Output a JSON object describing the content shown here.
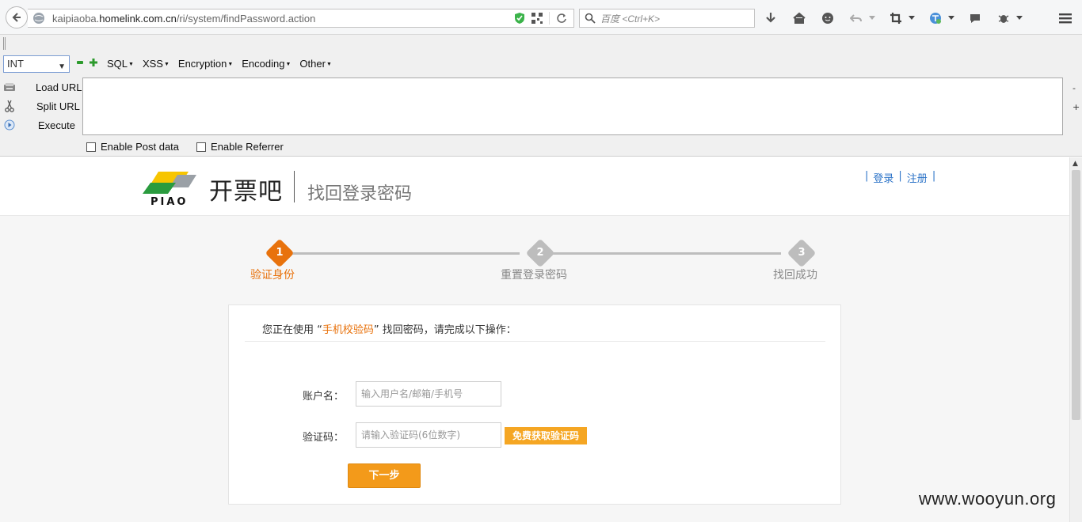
{
  "browser": {
    "url_prefix": "kaipiaoba.",
    "url_host": "homelink.com.cn",
    "url_path": "/ri/system/findPassword.action",
    "search_placeholder": "百度 <Ctrl+K>"
  },
  "hackbar": {
    "select_value": "INT",
    "menus": [
      "SQL",
      "XSS",
      "Encryption",
      "Encoding",
      "Other"
    ],
    "actions": [
      "Load URL",
      "Split URL",
      "Execute"
    ],
    "side_minus": "-",
    "side_plus": "+",
    "checkboxes": [
      "Enable Post data",
      "Enable Referrer"
    ]
  },
  "header": {
    "brand": "开票吧",
    "title": "找回登录密码",
    "login": "登录",
    "register": "注册",
    "bar": "|"
  },
  "steps": [
    {
      "num": "1",
      "label": "验证身份"
    },
    {
      "num": "2",
      "label": "重置登录密码"
    },
    {
      "num": "3",
      "label": "找回成功"
    }
  ],
  "form": {
    "intro_before": "您正在使用 “",
    "intro_highlight": "手机校验码",
    "intro_after": "” 找回密码，请完成以下操作：",
    "account_label": "账户名：",
    "account_placeholder": "输入用户名/邮箱/手机号",
    "code_label": "验证码：",
    "code_placeholder": "请输入验证码(6位数字)",
    "sms_button": "免费获取验证码",
    "next_button": "下一步"
  },
  "watermark": "www.wooyun.org",
  "colors": {
    "accent_orange": "#f39a1a",
    "link_blue": "#2a72c7",
    "step_active": "#e8720c",
    "step_inactive": "#bdbdbd"
  }
}
